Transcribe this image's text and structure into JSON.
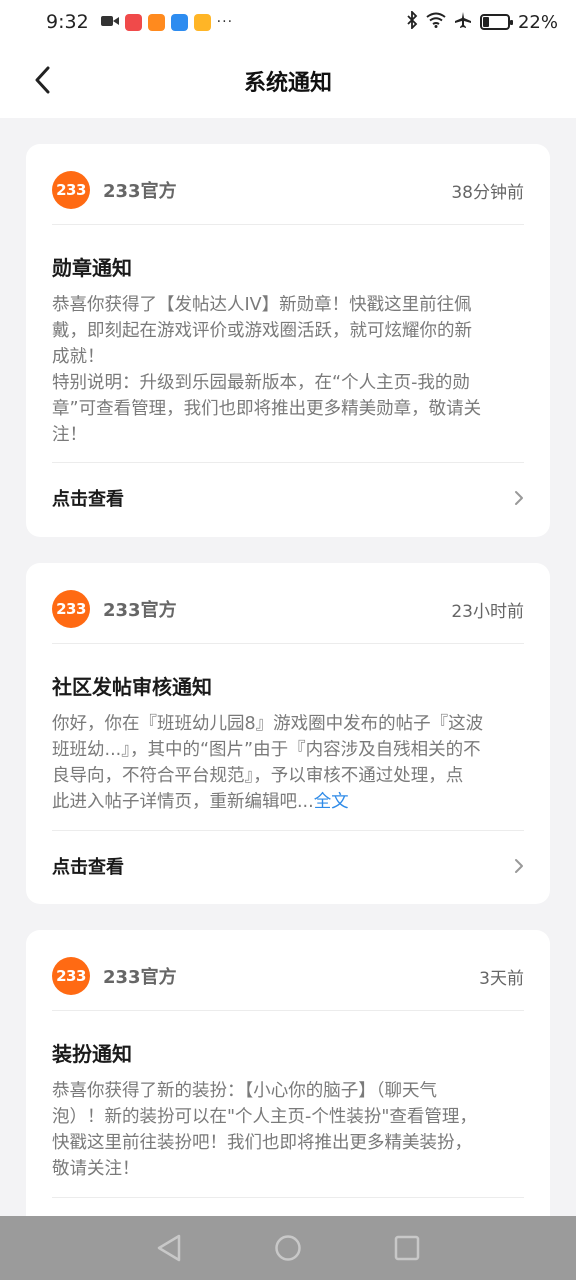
{
  "status_bar": {
    "time": "9:32",
    "battery_percent": "22%",
    "battery_level": 0.22,
    "more": "···",
    "icons": [
      "video-icon",
      "app-icon-red",
      "app-icon-orange",
      "app-icon-blue",
      "app-icon-yellow",
      "bluetooth-icon",
      "wifi-icon",
      "airplane-icon",
      "battery-icon"
    ]
  },
  "header": {
    "title": "系统通知"
  },
  "notifications": [
    {
      "logo": "233",
      "sender": "233官方",
      "time": "38分钟前",
      "title": "勋章通知",
      "body_lines": [
        "恭喜你获得了【发帖达人IV】新勋章！快戳这里前往佩",
        "戴，即刻起在游戏评价或游戏圈活跃，就可炫耀你的新",
        "成就！",
        "特别说明：升级到乐园最新版本，在“个人主页-我的勋",
        "章”可查看管理，我们也即将推出更多精美勋章，敬请关",
        "注！"
      ],
      "action": "点击查看"
    },
    {
      "logo": "233",
      "sender": "233官方",
      "time": "23小时前",
      "title": "社区发帖审核通知",
      "body_lines": [
        "你好，你在『班班幼儿园8』游戏圈中发布的帖子『这波",
        "班班幼...』，其中的“图片”由于『内容涉及自残相关的不",
        "良导向，不符合平台规范』，予以审核不通过处理，点",
        "此进入帖子详情页，重新编辑吧..."
      ],
      "full_text_link": "全文",
      "action": "点击查看"
    },
    {
      "logo": "233",
      "sender": "233官方",
      "time": "3天前",
      "title": "装扮通知",
      "body_lines": [
        "恭喜你获得了新的装扮：【小心你的脑子】（聊天气",
        "泡）！新的装扮可以在\"个人主页-个性装扮\"查看管理，",
        "快戳这里前往装扮吧！我们也即将推出更多精美装扮，",
        "敬请关注！"
      ]
    }
  ],
  "colors": {
    "brand_orange": "#ff6a13",
    "link_blue": "#2f8be8",
    "page_bg": "#f3f3f5",
    "nav_bar_bg": "#9b9b9b"
  }
}
